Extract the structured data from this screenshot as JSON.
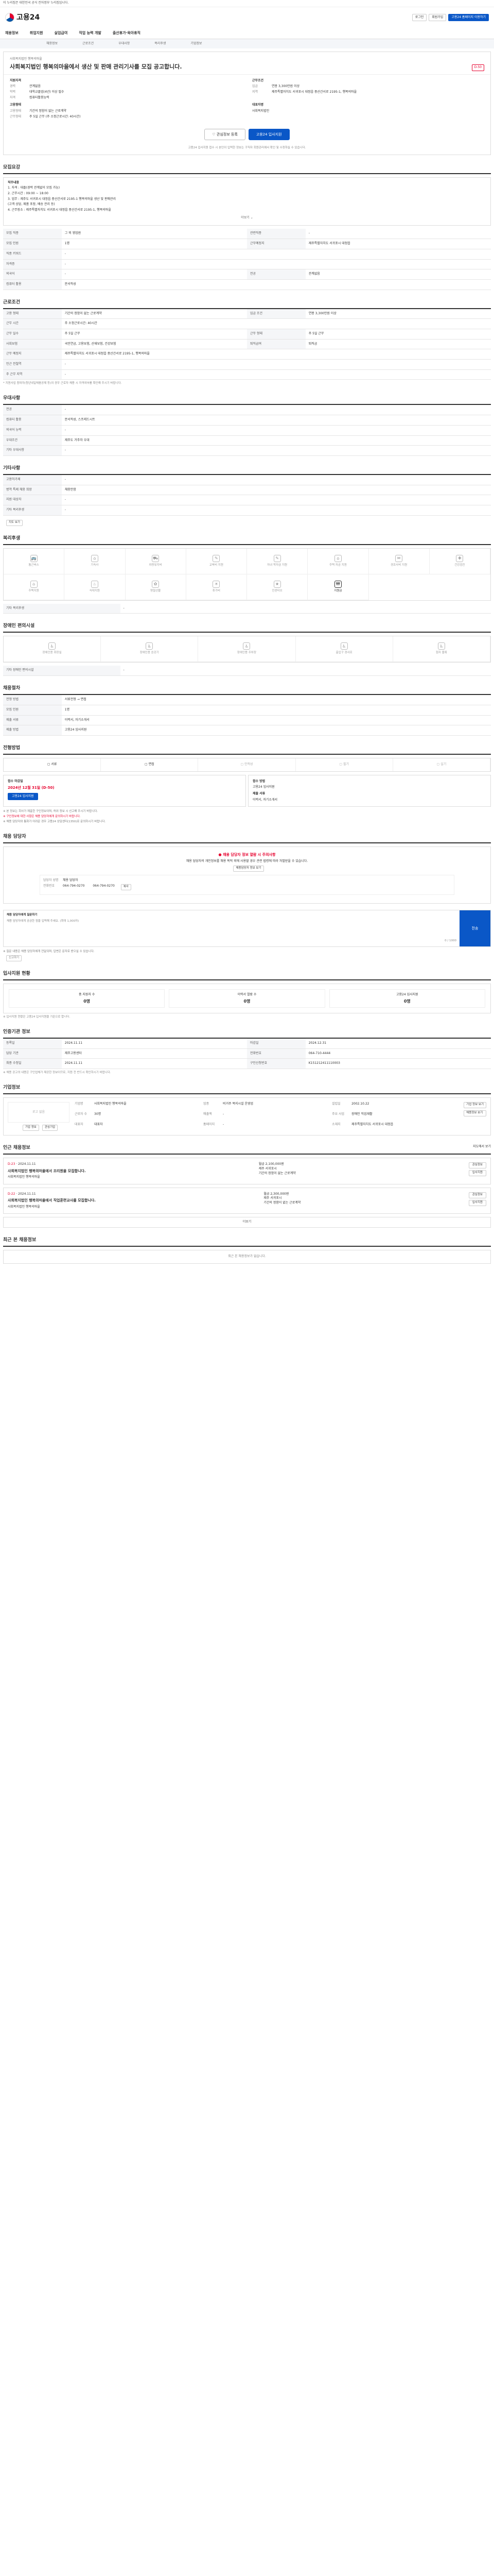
{
  "topbar": {
    "text": "이 누리집은 대한민국 공식 전자정부 누리집입니다."
  },
  "header": {
    "logo": "고용24",
    "right_btn1": "로그인",
    "right_btn2": "회원가입",
    "right_btn3": "고용24 홈페이지 이용하기"
  },
  "gnb": [
    "채용정보",
    "취업지원",
    "실업급여",
    "직업 능력 개발",
    "출산휴가·육아휴직"
  ],
  "lnb": [
    "채용정보",
    "근로조건",
    "우대사항",
    "복리후생",
    "기업정보"
  ],
  "job": {
    "company": "사회복지법인 행복의마을",
    "title": "사회복지법인 행복의마을에서 생산 및 판매 관리기사를 모집 공고합니다.",
    "dday": "D-50",
    "hiring_h": "지원자격",
    "hiring": [
      [
        "경력",
        "관계없음"
      ],
      [
        "학력",
        "대학교졸업(4년) 이상 필수"
      ],
      [
        "자격",
        "컴퓨터활용능력"
      ]
    ],
    "work_h": "근무조건",
    "work": [
      [
        "임금",
        "연봉 3,300만원 이상"
      ],
      [
        "지역",
        "제주특별자치도 서귀포시 대정읍 중산간서로 2195-1, 행복의마을"
      ]
    ],
    "reception_h": "고용형태",
    "reception": [
      [
        "고용형태",
        "기간의 정함이 없는 근로계약"
      ],
      [
        "근무형태",
        "주 5일 근무 (주 소정근로시간: 40시간)"
      ]
    ],
    "manager_h": "대표자명",
    "manager": "사회복지법인",
    "btn_scrap": "관심정보 등록",
    "btn_apply": "고용24 입사지원",
    "notice": "고용24 입사지원 접수 시 본인이 입력한 정보는 구직자 회원관리에서 확인 및 수정하실 수 있습니다."
  },
  "sec_recruit": {
    "title": "모집요강",
    "box_title": "직무내용",
    "box_lines": [
      "1. 자격 : 대졸(경력 관계없이 모집 가능)",
      "2. 근무시간 : 09:00 ~ 18:00",
      "3. 업무 : 제주도 서귀포시 대정읍 중산간서로 2195-1 행복의마을 생산 및 판매관리",
      "   (고객 상담, 제품 포장, 배송 관리 등)",
      "4. 근무장소 : 제주특별자치도 서귀포시 대정읍 중산간서로 2195-1, 행복의마을"
    ],
    "more": "더보기 ⌄",
    "rows": [
      [
        "모집 직종",
        "그 외 영업원",
        "관련직종",
        "-"
      ],
      [
        "모집 인원",
        "1명",
        "근무예정지",
        "제주특별자치도 서귀포시 대정읍"
      ],
      [
        "직종 키워드",
        "-",
        "",
        ""
      ],
      [
        "자격증",
        "-",
        "",
        ""
      ],
      [
        "외국어",
        "-",
        "전공",
        "관계없음"
      ],
      [
        "컴퓨터 활용",
        "문서작성",
        "",
        ""
      ]
    ]
  },
  "sec_work": {
    "title": "근로조건",
    "rows": [
      [
        "고용 형태",
        "기간의 정함이 없는 근로계약",
        "임금 조건",
        "연봉 3,300만원 이상"
      ],
      [
        "근무 시간",
        "주 소정근로시간: 40시간",
        "",
        ""
      ],
      [
        "근무 일수",
        "주 5일 근무",
        "근무 형태",
        "주 5일 근무"
      ],
      [
        "사회보험",
        "국민연금, 고용보험, 산재보험, 건강보험",
        "퇴직급여",
        "퇴직금"
      ],
      [
        "근무 예정지",
        "제주특별자치도 서귀포시 대정읍 중산간서로 2195-1, 행복의마을",
        "",
        ""
      ],
      [
        "인근 전철역",
        "-",
        "",
        ""
      ],
      [
        "주 근무 지역",
        "-",
        "",
        ""
      ]
    ],
    "note": "* 지원사업 참여자(청년내일채움공제 등)의 경우 근로자 채용 시 자격여부를 확인해 주시기 바랍니다."
  },
  "sec_pref": {
    "title": "우대사항",
    "rows": [
      [
        "전공",
        "-"
      ],
      [
        "컴퓨터 활용",
        "문서작성, 스프레드시트"
      ],
      [
        "외국어 능력",
        "-"
      ],
      [
        "우대조건",
        "제주도 거주자 우대"
      ],
      [
        "기타 우대사항",
        "-"
      ]
    ]
  },
  "sec_etc": {
    "title": "기타사항",
    "rows": [
      [
        "고용허가제",
        "-"
      ],
      [
        "병역 특례 채용 희망",
        "채용안함"
      ],
      [
        "지원 대상자",
        "-"
      ],
      [
        "기타 복리후생",
        "-"
      ]
    ],
    "map_btn": "지도 보기"
  },
  "sec_welfare": {
    "title": "복리후생",
    "icons": [
      "통근버스",
      "기숙사",
      "차량유지비",
      "교육비 지원",
      "자녀 학자금 지원",
      "주택 자금 지원",
      "경조사비 지원",
      "건강검진",
      "주택지원",
      "식대지원",
      "명절선물",
      "휴가비",
      "인센티브",
      "지원금"
    ],
    "active_index": 13,
    "etc_label": "기타 복리후생",
    "etc_value": "-"
  },
  "sec_disabled": {
    "title": "장애인 편의시설",
    "icons": [
      "장애인용 화장실",
      "장애인용 승강기",
      "장애인용 주차장",
      "출입구 경사로",
      "점자 블록"
    ],
    "etc_label": "기타 장애인 편의시설",
    "etc_value": "-"
  },
  "sec_apply": {
    "title": "채용절차",
    "rows": [
      [
        "전형 방법",
        "서류전형 → 면접"
      ],
      [
        "모집 인원",
        "1명"
      ],
      [
        "제출 서류",
        "이력서, 자기소개서"
      ],
      [
        "제출 방법",
        "고용24 입사지원"
      ]
    ]
  },
  "sec_method": {
    "title": "전형방법",
    "methods": [
      "서류",
      "면접",
      "인적성",
      "필기",
      "실기"
    ],
    "deadline_h": "접수 마감일",
    "deadline": "2024년 12월 31일 (D-50)",
    "deadline_btn": "고용24 입사지원",
    "docs_h": "접수 방법",
    "docs": "고용24 입사지원",
    "form_h": "제출 서류",
    "form": "이력서, 자기소개서",
    "bullets": [
      "※ 본 정보는 회사가 제출한 구인정보이며, 허위 정보 시 신고해 주시기 바랍니다.",
      "※ 구인정보에 대한 사항은 채용 담당자에게 문의하시기 바랍니다.",
      "※ 채용 담당자와 통화가 어려운 경우 고용24 상담센터(1350)로 문의하시기 바랍니다."
    ]
  },
  "sec_manager": {
    "title": "채용 담당자",
    "warn_title": "채용 담당자 정보 열람 시 주의사항",
    "warn_desc": "채용 담당자의 개인정보를 채용 목적 외에 사용할 경우 관련 법령에 따라 처벌받을 수 있습니다.",
    "warn_btn": "채용담당자 정보 보기",
    "name_label": "담당자 성명",
    "name": "채용 담당자",
    "tel_label": "전화번호",
    "tel": "064-794-0270",
    "fax": "064-794-0270",
    "btn": "복사"
  },
  "sec_qa": {
    "title": "채용 담당자에게 질문하기",
    "placeholder": "채용 담당자에게 궁금한 점을 입력해 주세요. (최대 1,000자)",
    "send": "전송",
    "count": "0 / 1000",
    "bullets": [
      "※ 질문 내용은 채용 담당자에게 전달되며, 답변은 문자로 받으실 수 있습니다."
    ],
    "report_btn": "신고하기"
  },
  "sec_stats": {
    "title": "입사지원 현황",
    "items": [
      [
        "총 지원자 수",
        "0명"
      ],
      [
        "이력서 열람 수",
        "0명"
      ],
      [
        "고용24 입사지원",
        "0명"
      ]
    ],
    "note": "※ 입사지원 현황은 고용24 입사지원을 기준으로 합니다."
  },
  "sec_info": {
    "title": "인증기관 정보",
    "rows": [
      [
        "등록일",
        "2024.11.11",
        "마감일",
        "2024.12.31"
      ],
      [
        "담당 기관",
        "제주고용센터",
        "전화번호",
        "064-710-4444"
      ],
      [
        "최종 수정일",
        "2024.11.11",
        "구인신청번호",
        "K151212411110003"
      ]
    ],
    "note": "※ 채용 공고의 내용은 구인업체가 제공한 정보이므로, 지원 전 반드시 확인하시기 바랍니다."
  },
  "sec_company": {
    "title": "기업정보",
    "logo_btn": "로고 없음",
    "btn1": "기업 정보",
    "btn2": "관심기업",
    "info": [
      [
        "기업명",
        "사회복지법인 행복의마을"
      ],
      [
        "업종",
        "비거주 복지시설 운영업"
      ],
      [
        "설립일",
        "2002.10.22"
      ],
      [
        "근로자 수",
        "30명"
      ],
      [
        "매출액",
        "-"
      ],
      [
        "주요 사업",
        "장애인 직업재활"
      ],
      [
        "대표자",
        "대표자"
      ],
      [
        "홈페이지",
        "-"
      ],
      [
        "소재지",
        "제주특별자치도 서귀포시 대정읍"
      ]
    ],
    "side_btn1": "기업 정보 보기",
    "side_btn2": "채용정보 보기"
  },
  "sec_other": {
    "title": "인근 채용정보",
    "link": "지도에서 보기",
    "jobs": [
      {
        "dday": "D-23",
        "date": "2024.11.11",
        "title": "사회복지법인 행복의마을에서 조리원을 모집합니다.",
        "company": "사회복지법인 행복의마을",
        "salary": "월급 2,100,000원",
        "region": "제주 서귀포시",
        "type": "기간의 정함이 없는 근로계약",
        "b1": "관심정보",
        "b2": "입사지원"
      },
      {
        "dday": "D-22",
        "date": "2024.11.11",
        "title": "사회복지법인 행복의마을에서 직업훈련교사를 모집합니다.",
        "company": "사회복지법인 행복의마을",
        "salary": "월급 2,300,000원",
        "region": "제주 서귀포시",
        "type": "기간의 정함이 없는 근로계약",
        "b1": "관심정보",
        "b2": "입사지원"
      }
    ],
    "more": "더보기"
  },
  "sec_recent": {
    "title": "최근 본 채용정보",
    "empty": "최근 본 채용정보가 없습니다."
  }
}
